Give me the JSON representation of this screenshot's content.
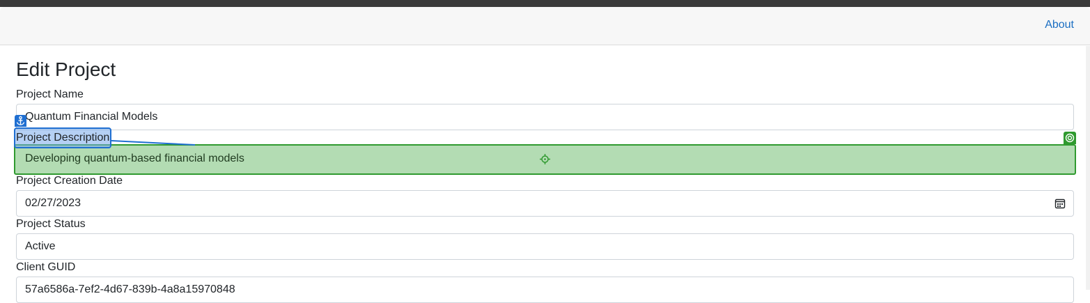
{
  "nav": {
    "about_label": "About"
  },
  "page": {
    "title": "Edit Project"
  },
  "form": {
    "project_name": {
      "label": "Project Name",
      "value": "Quantum Financial Models"
    },
    "project_description": {
      "label": "Project Description",
      "value": "Developing quantum-based financial models"
    },
    "project_creation_date": {
      "label": "Project Creation Date",
      "value": "02/27/2023"
    },
    "project_status": {
      "label": "Project Status",
      "value": "Active"
    },
    "client_guid": {
      "label": "Client GUID",
      "value": "57a6586a-7ef2-4d67-839b-4a8a15970848"
    }
  },
  "overlay": {
    "anchor_icon": "anchor-icon",
    "target_icon": "target-icon",
    "crosshair_icon": "crosshair-icon",
    "anchor_color": "#1f6fd1",
    "target_color": "#2f9a2f"
  }
}
